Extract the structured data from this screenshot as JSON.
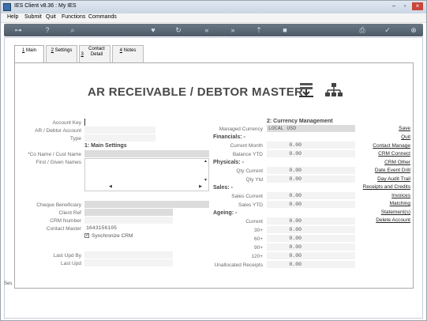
{
  "window": {
    "title": "IES Client v8.36 : My IES"
  },
  "menu": [
    "Help",
    "Submit",
    "Quit",
    "Functions",
    "Commands"
  ],
  "tabs": [
    {
      "key": "1",
      "label": "Main",
      "active": true
    },
    {
      "key": "2",
      "label": "Settings"
    },
    {
      "key": "3",
      "label": "Contact Detail"
    },
    {
      "key": "4",
      "label": "Notes"
    }
  ],
  "page_title": "AR RECEIVABLE / DEBTOR MASTER",
  "left": {
    "account_key": "Account Key",
    "debtor_account": "AR / Debtor Account",
    "type": "Type",
    "main_settings": "1: Main Settings",
    "co_name": "*Co Name / Cust Name",
    "first_names": "First / Given Names",
    "cheque_beneficiary": "Cheque Beneficiary",
    "client_ref": "Client Ref",
    "crm_number": "CRM Number",
    "contact_master": "Contact Master",
    "contact_master_value": "1643156105",
    "synchronize_crm": "Synchronize CRM",
    "last_upd_by": "Last Upd By",
    "last_upd": "Last Upd"
  },
  "middle": {
    "currency_management": "2: Currency Management",
    "managed_currency": "Managed Currency",
    "managed_currency_value": "LOCAL USD",
    "financials": "Financials: -",
    "current_month": "Current Month",
    "balance_ytd": "Balance YTD",
    "physicals": "Physicals: -",
    "qty_current": "Qty Current",
    "qty_ytd": "Qty Ytd",
    "sales": "Sales: -",
    "sales_current": "Sales Current",
    "sales_ytd": "Sales YTD",
    "ageing": "Ageing: -",
    "current": "Current",
    "d30": "30+",
    "d60": "60+",
    "d90": "90+",
    "d120": "120+",
    "unallocated": "Unallocated Receipts",
    "zero": "0.00"
  },
  "actions": [
    "Save",
    "Quit",
    "Contact Manage",
    "CRM Connect",
    "CRM Other",
    "Date Event Drill",
    "Day Audit Trail",
    "Receipts and Credits",
    "Invoices",
    "Matching",
    "Statement(s)",
    "Delete Account"
  ],
  "left_strip": "Ses"
}
